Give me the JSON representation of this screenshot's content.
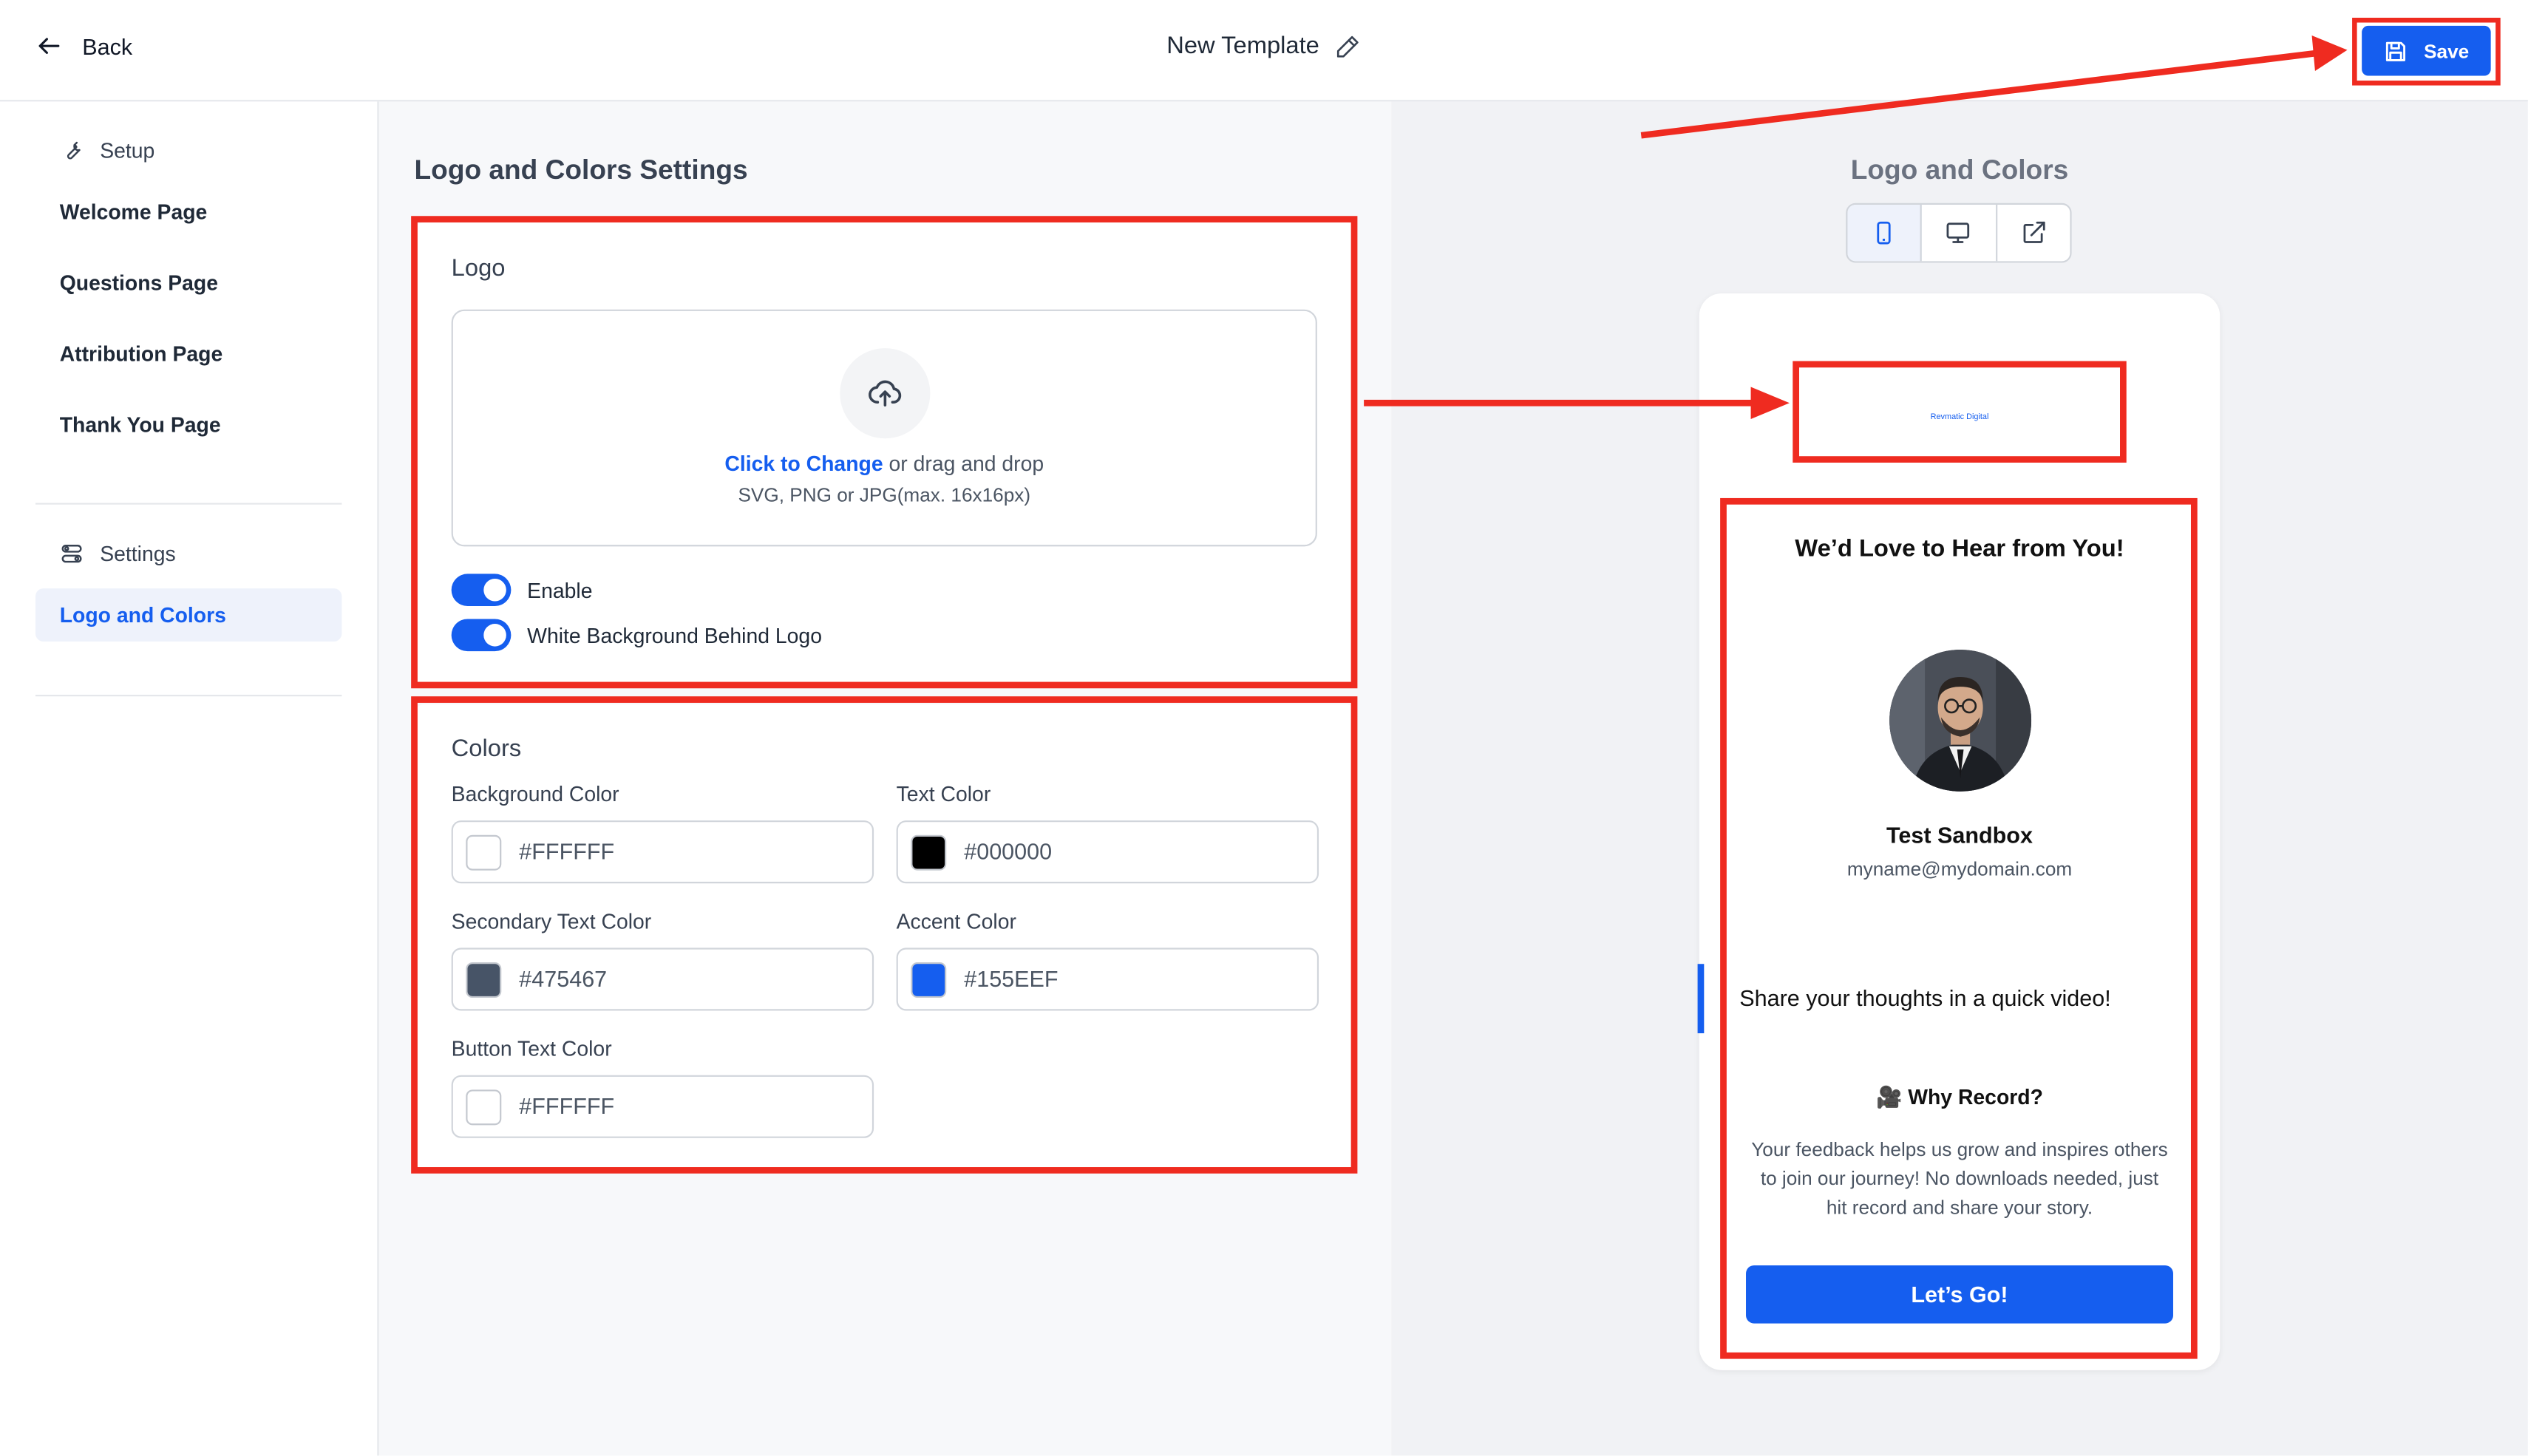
{
  "header": {
    "back_label": "Back",
    "title": "New Template",
    "save_label": "Save"
  },
  "sidebar": {
    "setup_heading": "Setup",
    "pages": [
      "Welcome Page",
      "Questions Page",
      "Attribution Page",
      "Thank You Page"
    ],
    "settings_heading": "Settings",
    "active_item": "Logo and Colors"
  },
  "settings": {
    "section_title": "Logo and Colors Settings",
    "logo": {
      "title": "Logo",
      "upload_link": "Click to Change",
      "upload_rest": " or drag and drop",
      "upload_hint": "SVG, PNG or JPG(max. 16x16px)",
      "toggles": [
        {
          "label": "Enable",
          "on": true
        },
        {
          "label": "White Background Behind Logo",
          "on": true
        }
      ]
    },
    "colors": {
      "title": "Colors",
      "fields": [
        {
          "label": "Background Color",
          "value": "#FFFFFF"
        },
        {
          "label": "Text Color",
          "value": "#000000"
        },
        {
          "label": "Secondary Text Color",
          "value": "#475467"
        },
        {
          "label": "Accent Color",
          "value": "#155EEF"
        },
        {
          "label": "Button Text Color",
          "value": "#FFFFFF"
        }
      ]
    }
  },
  "preview": {
    "title": "Logo and Colors",
    "devices": [
      "phone-icon",
      "desktop-icon",
      "external-link-icon"
    ],
    "logo_text": "Revmatic Digital",
    "heading": "We’d Love to Hear from You!",
    "name": "Test Sandbox",
    "email": "myname@mydomain.com",
    "share_text": "Share your thoughts in a quick video!",
    "why_title": "🎥 Why Record?",
    "body": "Your feedback helps us grow and inspires others to join our journey! No downloads needed, just hit record and share your story.",
    "button_label": "Let’s Go!"
  },
  "colors": {
    "accent": "#155EEF",
    "annotation_red": "#EF2B20"
  }
}
